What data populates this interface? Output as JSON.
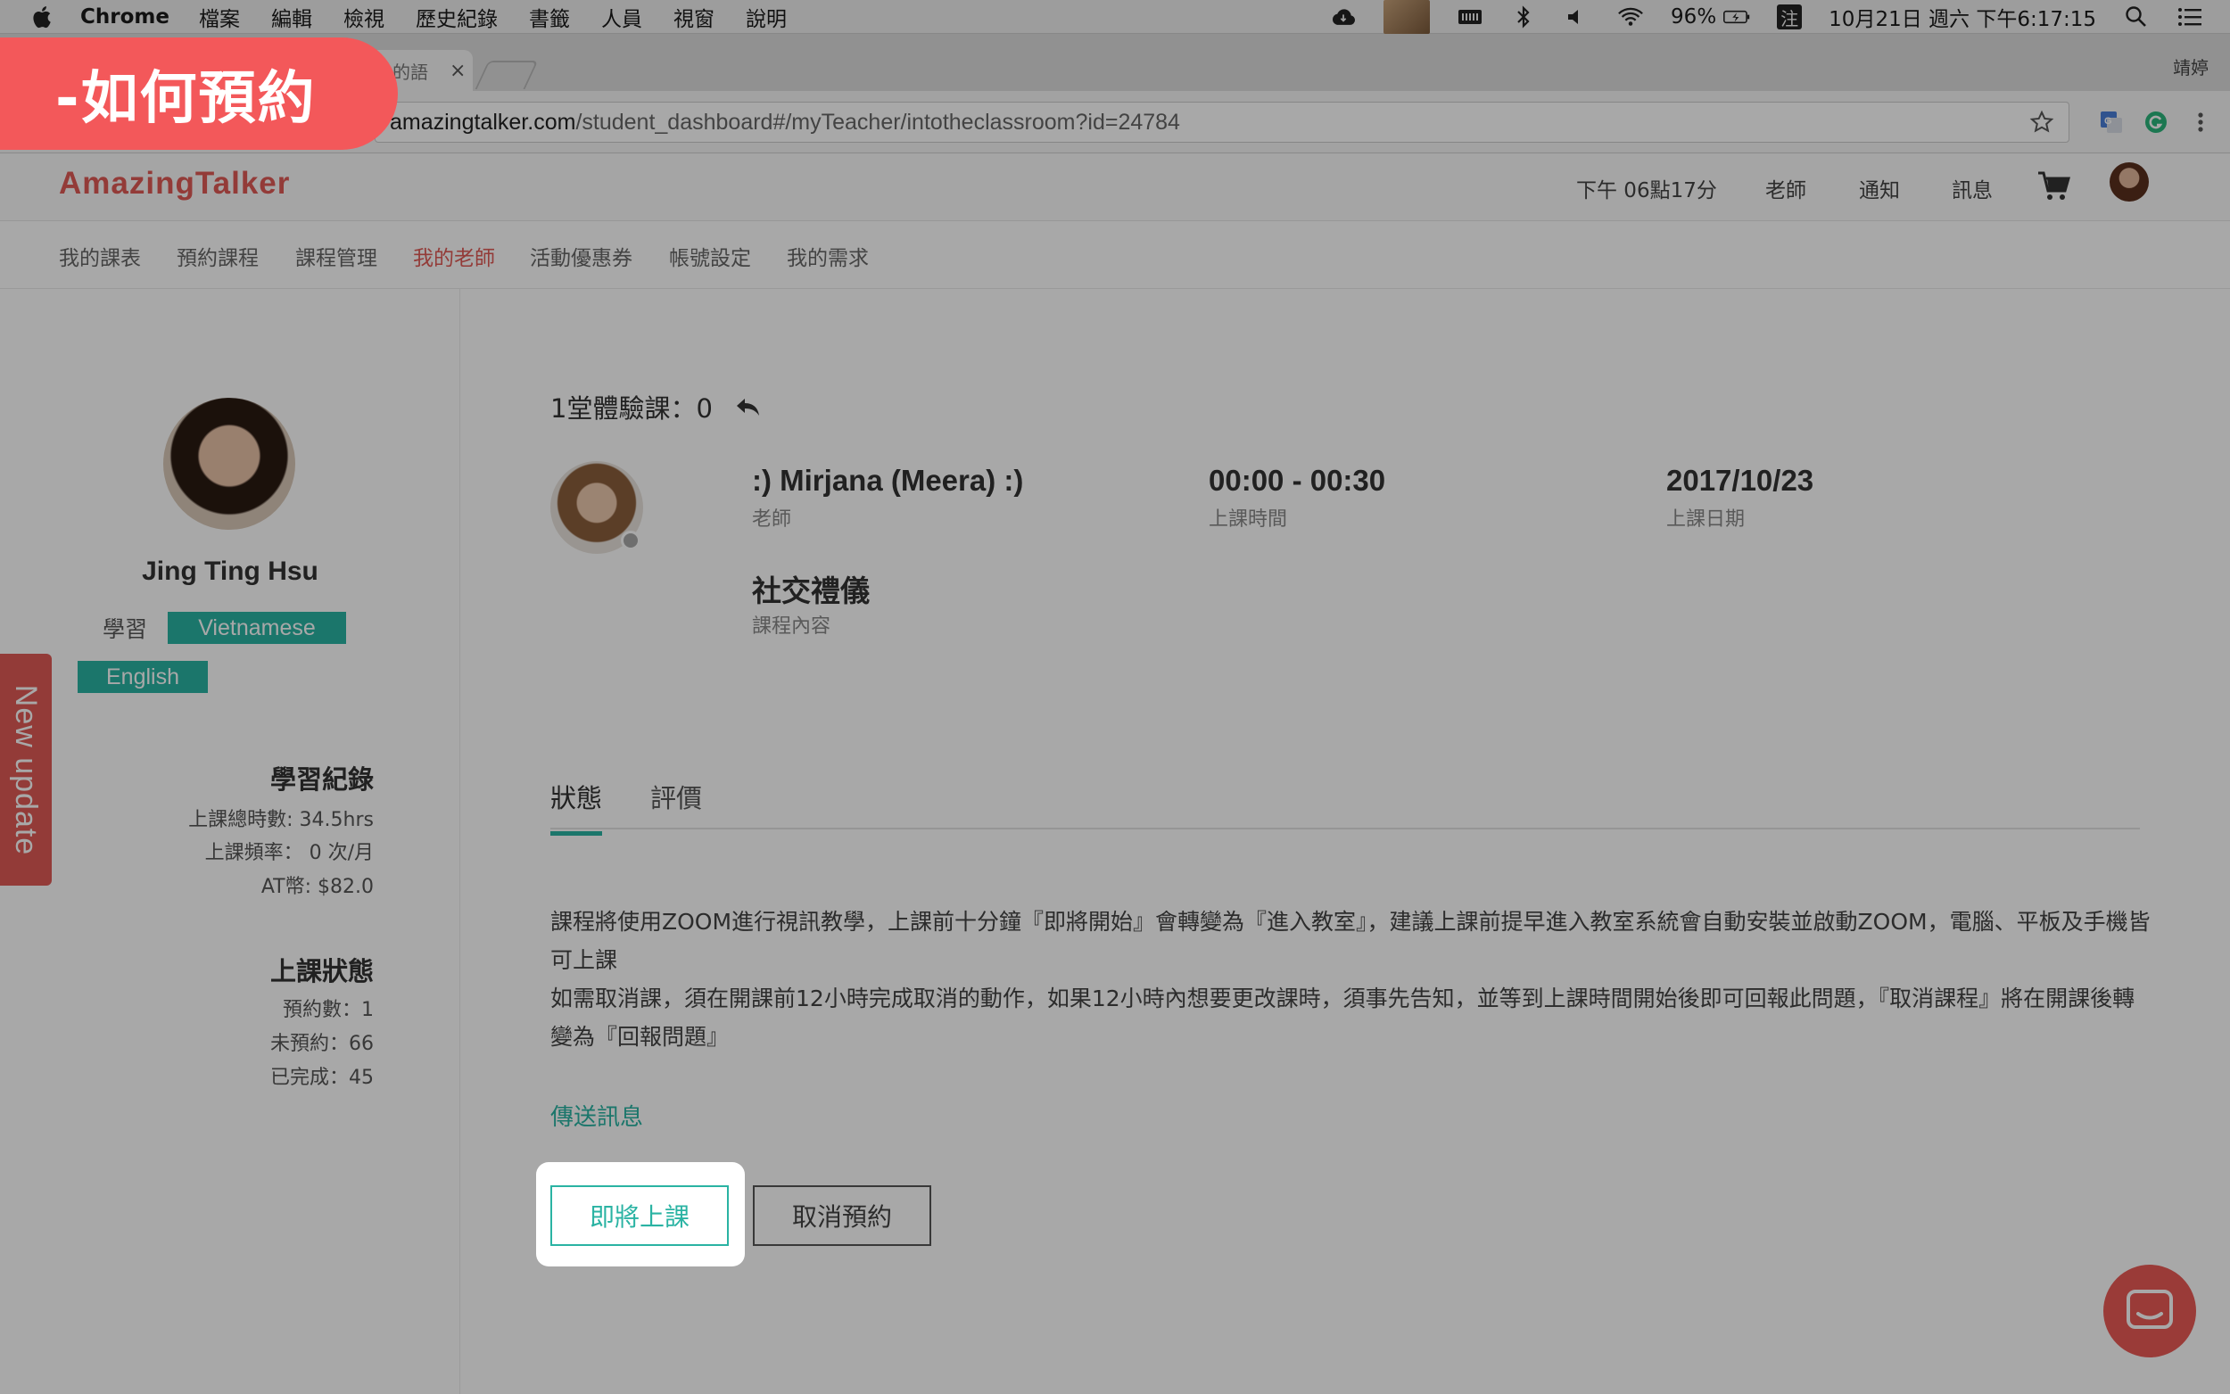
{
  "menubar": {
    "app": "Chrome",
    "items": [
      "檔案",
      "編輯",
      "檢視",
      "歷史紀錄",
      "書籤",
      "人員",
      "視窗",
      "說明"
    ],
    "battery": "96%",
    "input_method": "注",
    "clock": "10月21日 週六 下午6:17:15"
  },
  "browser": {
    "tab_title": "的語",
    "tab_close": "×",
    "profile_name": "靖婷",
    "url_host": "amazingtalker.com",
    "url_path": "/student_dashboard#/myTeacher/intotheclassroom?id=24784"
  },
  "site": {
    "logo": "AmazingTalker",
    "header": {
      "time": "下午 06點17分",
      "teacher": "老師",
      "notify": "通知",
      "message": "訊息"
    },
    "subnav": [
      "我的課表",
      "預約課程",
      "課程管理",
      "我的老師",
      "活動優惠券",
      "帳號設定",
      "我的需求"
    ],
    "subnav_active_index": 3
  },
  "sidebar": {
    "name": "Jing Ting Hsu",
    "learn_label": "學習",
    "languages": [
      "Vietnamese",
      "English"
    ],
    "record_title": "學習紀錄",
    "total_hours": "上課總時數: 34.5hrs",
    "frequency": "上課頻率： 0 次/月",
    "at_coins": "AT幣: $82.0",
    "status_title": "上課狀態",
    "booked": "預約數：1",
    "unbooked": "未預約：66",
    "completed": "已完成：45"
  },
  "main": {
    "trial_count": "1堂體驗課：0",
    "teacher_name": ":) Mirjana (Meera) :)",
    "teacher_label": "老師",
    "class_time": "00:00 - 00:30",
    "class_time_label": "上課時間",
    "class_date": "2017/10/23",
    "class_date_label": "上課日期",
    "course": "社交禮儀",
    "course_label": "課程內容",
    "tabs": [
      "狀態",
      "評價"
    ],
    "notice_line1": "課程將使用ZOOM進行視訊教學，上課前十分鐘『即將開始』會轉變為『進入教室』，建議上課前提早進入教室系統會自動安裝並啟動ZOOM，電腦、平板及手機皆可上課",
    "notice_line2": "如需取消課，須在開課前12小時完成取消的動作，如果12小時內想要更改課時，須事先告知，並等到上課時間開始後即可回報此問題，『取消課程』將在開課後轉變為『回報問題』",
    "send_message": "傳送訊息",
    "enter_button": "即將上課",
    "cancel_button": "取消預約"
  },
  "side_tab": "New update",
  "banner": "-如何預約",
  "colors": {
    "brand_red": "#e05a56",
    "accent_teal": "#2ab3a3",
    "banner_red": "#f3585a"
  }
}
